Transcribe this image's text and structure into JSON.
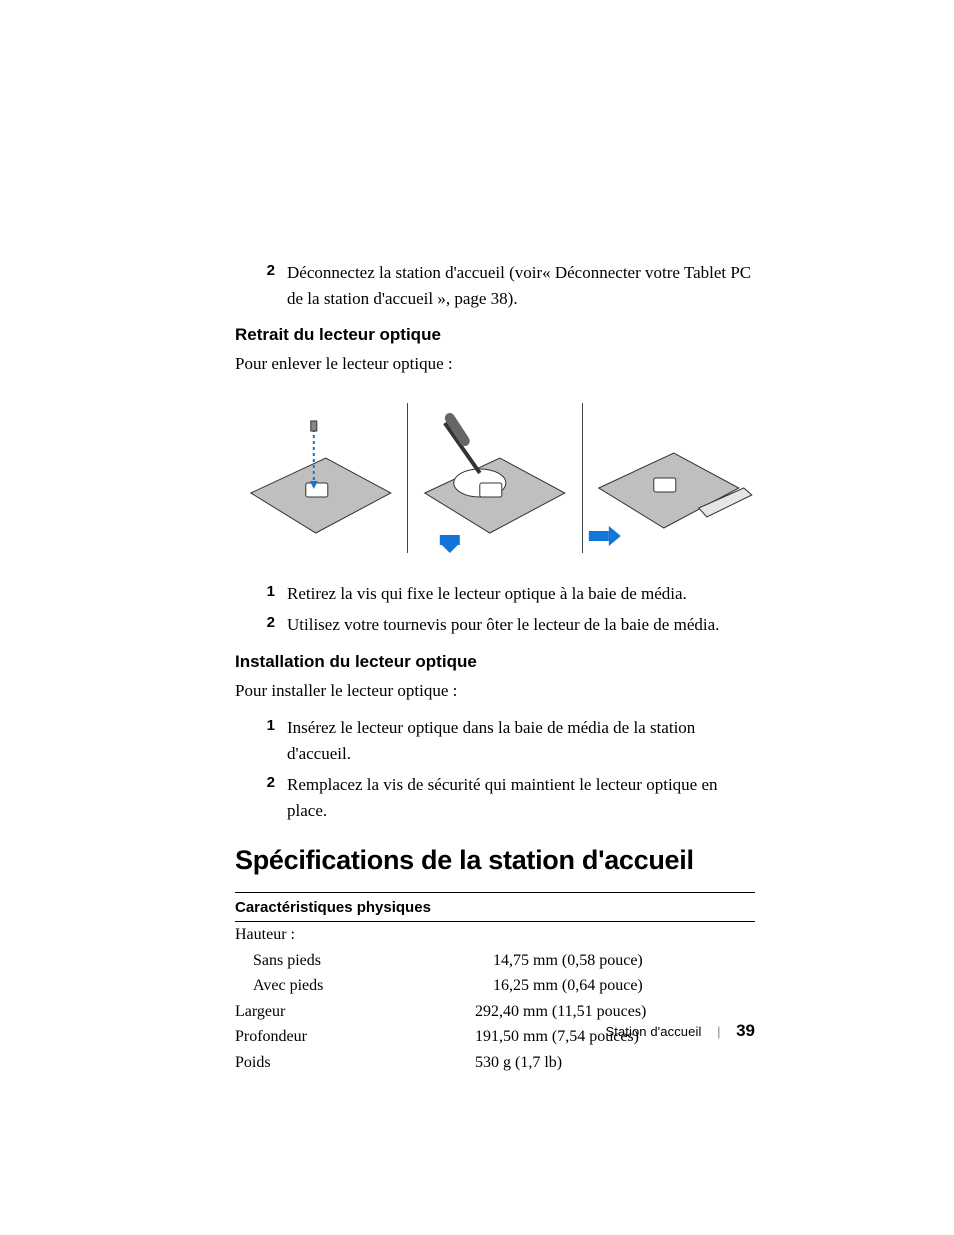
{
  "top_list": [
    {
      "n": "2",
      "t": "Déconnectez la station d'accueil (voir« Déconnecter votre Tablet PC de la station d'accueil », page 38)."
    }
  ],
  "section_remove": {
    "heading": "Retrait du lecteur optique",
    "intro": "Pour enlever le lecteur optique :",
    "steps": [
      {
        "n": "1",
        "t": "Retirez la vis qui fixe le lecteur optique à la baie de média."
      },
      {
        "n": "2",
        "t": "Utilisez votre tournevis pour ôter le lecteur de la baie de média."
      }
    ]
  },
  "section_install": {
    "heading": "Installation du lecteur optique",
    "intro": "Pour installer le lecteur optique :",
    "steps": [
      {
        "n": "1",
        "t": "Insérez le lecteur optique dans la baie de média de la station d'accueil."
      },
      {
        "n": "2",
        "t": "Remplacez la vis de sécurité qui maintient le lecteur optique en place."
      }
    ]
  },
  "specs": {
    "heading": "Spécifications de la station d'accueil",
    "table_heading": "Caractéristiques physiques",
    "rows": [
      {
        "label": "Hauteur :",
        "value": "",
        "indent": false
      },
      {
        "label": "Sans pieds",
        "value": "14,75 mm (0,58 pouce)",
        "indent": true
      },
      {
        "label": "Avec pieds",
        "value": "16,25 mm (0,64 pouce)",
        "indent": true
      },
      {
        "label": "Largeur",
        "value": "292,40 mm (11,51 pouces)",
        "indent": false
      },
      {
        "label": "Profondeur",
        "value": "191,50 mm (7,54 pouces)",
        "indent": false
      },
      {
        "label": "Poids",
        "value": "530 g (1,7 lb)",
        "indent": false
      }
    ]
  },
  "footer": {
    "section": "Station d'accueil",
    "page": "39"
  }
}
